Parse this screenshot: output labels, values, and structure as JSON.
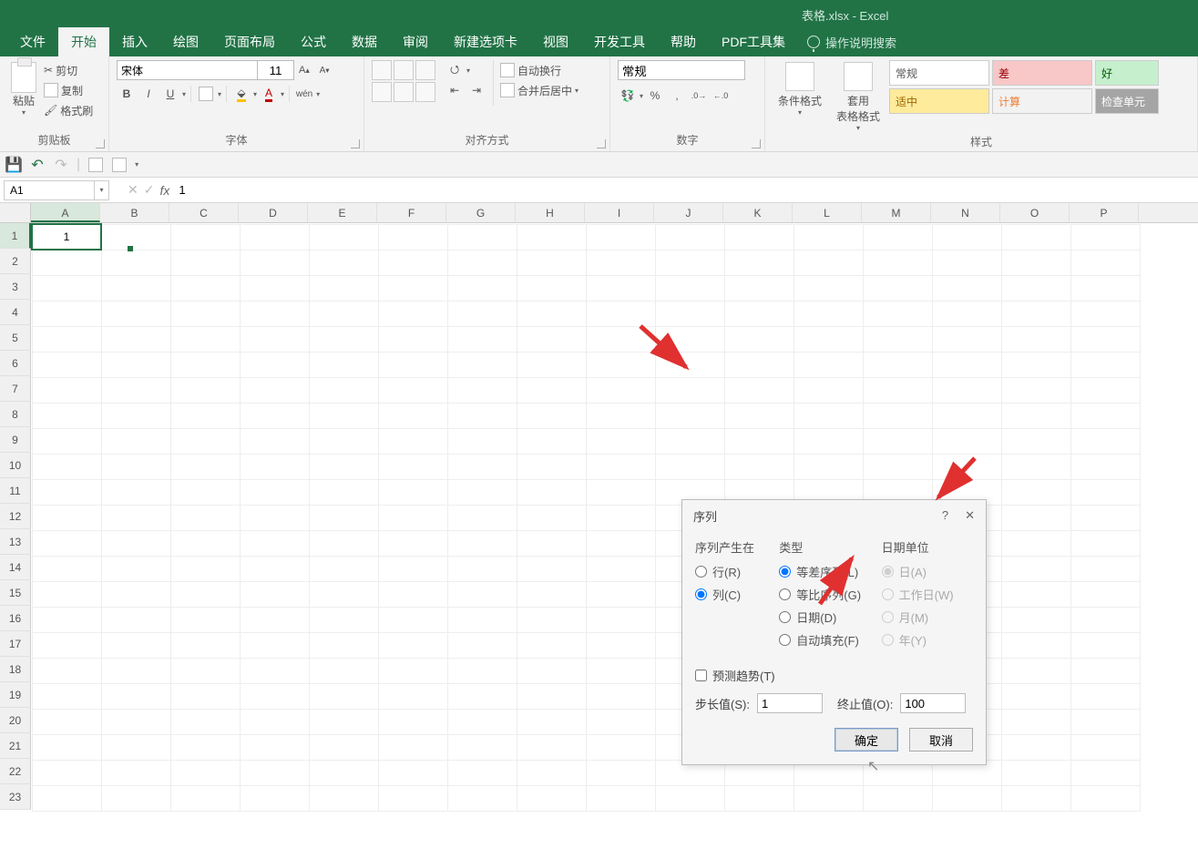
{
  "title": "表格.xlsx  -  Excel",
  "tabs": [
    "文件",
    "开始",
    "插入",
    "绘图",
    "页面布局",
    "公式",
    "数据",
    "审阅",
    "新建选项卡",
    "视图",
    "开发工具",
    "帮助",
    "PDF工具集"
  ],
  "active_tab": 1,
  "search_hint": "操作说明搜索",
  "ribbon": {
    "clipboard": {
      "label": "剪贴板",
      "paste": "粘贴",
      "cut": "剪切",
      "copy": "复制",
      "painter": "格式刷"
    },
    "font": {
      "label": "字体",
      "name": "宋体",
      "size": "11",
      "bold": "B",
      "italic": "I",
      "underline": "U"
    },
    "align": {
      "label": "对齐方式",
      "wrap": "自动换行",
      "merge": "合并后居中"
    },
    "number": {
      "label": "数字",
      "format": "常规"
    },
    "styles": {
      "label": "样式",
      "cond": "条件格式",
      "table": "套用\n表格格式",
      "g1": "常规",
      "g2": "差",
      "g3": "好",
      "g4": "适中",
      "g5": "计算",
      "g6": "检查单元"
    }
  },
  "namebox": "A1",
  "formula": "1",
  "columns": [
    "A",
    "B",
    "C",
    "D",
    "E",
    "F",
    "G",
    "H",
    "I",
    "J",
    "K",
    "L",
    "M",
    "N",
    "O",
    "P"
  ],
  "rows": 23,
  "cell_A1": "1",
  "dialog": {
    "title": "序列",
    "grp_in": "序列产生在",
    "opt_row": "行(R)",
    "opt_col": "列(C)",
    "grp_type": "类型",
    "opt_linear": "等差序列(L)",
    "opt_growth": "等比序列(G)",
    "opt_date": "日期(D)",
    "opt_autofill": "自动填充(F)",
    "grp_dateunit": "日期单位",
    "opt_day": "日(A)",
    "opt_weekday": "工作日(W)",
    "opt_month": "月(M)",
    "opt_year": "年(Y)",
    "trend": "预测趋势(T)",
    "step_label": "步长值(S):",
    "step_value": "1",
    "stop_label": "终止值(O):",
    "stop_value": "100",
    "ok": "确定",
    "cancel": "取消"
  }
}
